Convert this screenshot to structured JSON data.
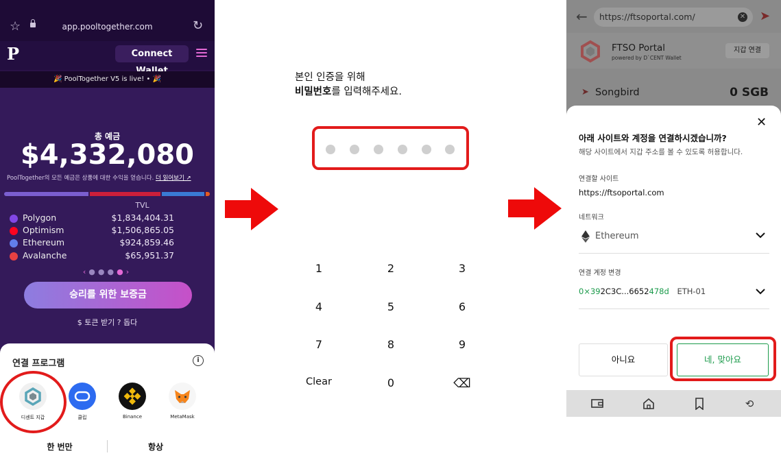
{
  "panel1": {
    "url": "app.pooltogether.com",
    "logo": "P",
    "connect_wallet": "Connect Wallet",
    "banner": "🎉 PoolTogether V5 is live! • 🎉",
    "total_label": "총 예금",
    "total_amount": "$4,332,080",
    "description": "PoolTogether의 모든 예금은 상품에 대한 수익을 얻습니다.",
    "more_link": "더 읽어보기 ↗",
    "tvl_label": "TVL",
    "tvl_bar_colors": [
      "#7b5fd0",
      "#cc1f3a",
      "#3a7bd5",
      "#e65b1f"
    ],
    "chains": [
      {
        "name": "Polygon",
        "value": "$1,834,404.31",
        "color": "#8247e5"
      },
      {
        "name": "Optimism",
        "value": "$1,506,865.05",
        "color": "#ff0420"
      },
      {
        "name": "Ethereum",
        "value": "$924,859.46",
        "color": "#627eea"
      },
      {
        "name": "Avalanche",
        "value": "$65,951.37",
        "color": "#e84142"
      }
    ],
    "cta": "승리를 위한 보증금",
    "links": "$ 토큰 받기    ? 돕다",
    "sheet_title": "연결 프로그램",
    "info_icon": "i",
    "apps": [
      {
        "label": "디센트 지갑",
        "icon": "dcent-icon"
      },
      {
        "label": "클립",
        "icon": "klip-icon"
      },
      {
        "label": "Binance",
        "icon": "binance-icon"
      },
      {
        "label": "MetaMask",
        "icon": "metamask-icon"
      }
    ],
    "once": "한 번만",
    "always": "항상"
  },
  "panel2": {
    "line1": "본인 인증을 위해",
    "line2_bold": "비밀번호",
    "line2_rest": "를 입력해주세요.",
    "keys": [
      "1",
      "2",
      "3",
      "4",
      "5",
      "6",
      "7",
      "8",
      "9",
      "Clear",
      "0",
      "⌫"
    ]
  },
  "panel3": {
    "url": "https://ftsoportal.com/",
    "app_name": "FTSO Portal",
    "powered": "powered by D`CENT Wallet",
    "wallet_connect": "지갑 연결",
    "token": "Songbird",
    "token_value": "0 SGB",
    "modal_title": "아래 사이트와 계정을 연결하시겠습니까?",
    "modal_sub": "해당 사이트에서 지갑 주소를 볼 수 있도록 허용합니다.",
    "site_label": "연결할 사이트",
    "site": "https://ftsoportal.com",
    "network_label": "네트워크",
    "network": "Ethereum",
    "account_label": "연결 계정 변경",
    "account_prefix": "0×39",
    "account_mid": "2C3C...6652",
    "account_suffix": "478d",
    "account_name": "ETH-01",
    "no": "아니요",
    "yes": "네, 맞아요"
  }
}
